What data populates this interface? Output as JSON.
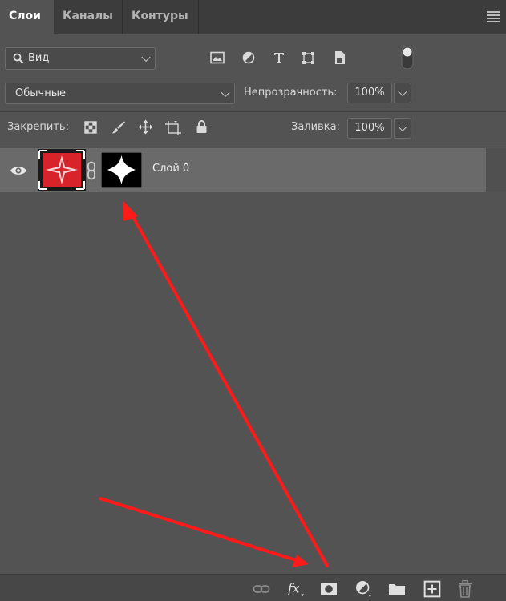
{
  "tabs": [
    {
      "label": "Слои",
      "active": true
    },
    {
      "label": "Каналы",
      "active": false
    },
    {
      "label": "Контуры",
      "active": false
    }
  ],
  "filter": {
    "label": "Вид"
  },
  "blend_mode": {
    "value": "Обычные"
  },
  "opacity": {
    "label": "Непрозрачность:",
    "value": "100%"
  },
  "lock": {
    "label": "Закрепить:"
  },
  "fill": {
    "label": "Заливка:",
    "value": "100%"
  },
  "layers": [
    {
      "name": "Слой 0",
      "visible": true,
      "has_mask": true
    }
  ],
  "filter_icons": [
    "image-filter-icon",
    "adjustment-filter-icon",
    "type-filter-icon",
    "shape-filter-icon",
    "smart-object-filter-icon",
    "filter-toggle-icon"
  ],
  "lock_icons": [
    "lock-transparent-pixels-icon",
    "lock-image-pixels-icon",
    "lock-position-icon",
    "lock-artboard-icon",
    "lock-all-icon"
  ],
  "bottom_icons": [
    "link-layers-icon",
    "fx-icon",
    "add-mask-icon",
    "adjustment-layer-icon",
    "new-group-icon",
    "new-layer-icon",
    "delete-layer-icon"
  ],
  "colors": {
    "panel": "#535353",
    "tabbar": "#3c3c3c",
    "selected_row": "#6a6a6a",
    "annotation_arrow": "#ff1a1a",
    "thumb_red": "#d8232a"
  }
}
